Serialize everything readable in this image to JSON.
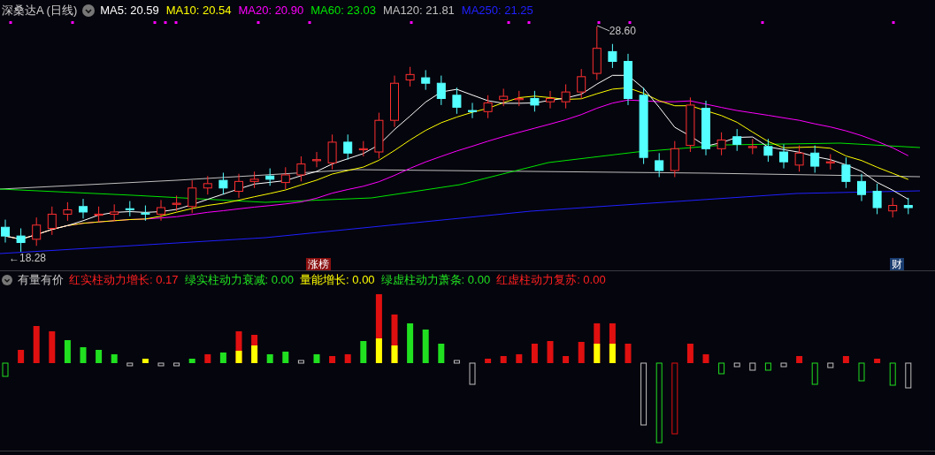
{
  "title": {
    "name": "深桑达A (日线)"
  },
  "ma_legend": [
    {
      "label": "MA5: 20.59",
      "color": "#ffffff"
    },
    {
      "label": "MA10: 20.54",
      "color": "#ffff00"
    },
    {
      "label": "MA20: 20.90",
      "color": "#ff00ff"
    },
    {
      "label": "MA60: 23.03",
      "color": "#00e600"
    },
    {
      "label": "MA120: 21.81",
      "color": "#c0c0c0"
    },
    {
      "label": "MA250: 21.25",
      "color": "#2020ff"
    }
  ],
  "main_chart": {
    "high_label": "28.60",
    "low_label": "←18.28",
    "markers": [
      {
        "kind": "rank",
        "text": "涨榜"
      },
      {
        "kind": "finance",
        "text": "财"
      }
    ]
  },
  "indicator": {
    "name": "有量有价",
    "legend": [
      {
        "label": "红实柱动力增长: 0.17",
        "color": "#ff2020"
      },
      {
        "label": "绿实柱动力衰减: 0.00",
        "color": "#20e020"
      },
      {
        "label": "量能增长: 0.00",
        "color": "#ffff00"
      },
      {
        "label": "绿虚柱动力萧条: 0.00",
        "color": "#20e020"
      },
      {
        "label": "红虚柱动力复苏: 0.00",
        "color": "#ff2020"
      }
    ]
  }
}
